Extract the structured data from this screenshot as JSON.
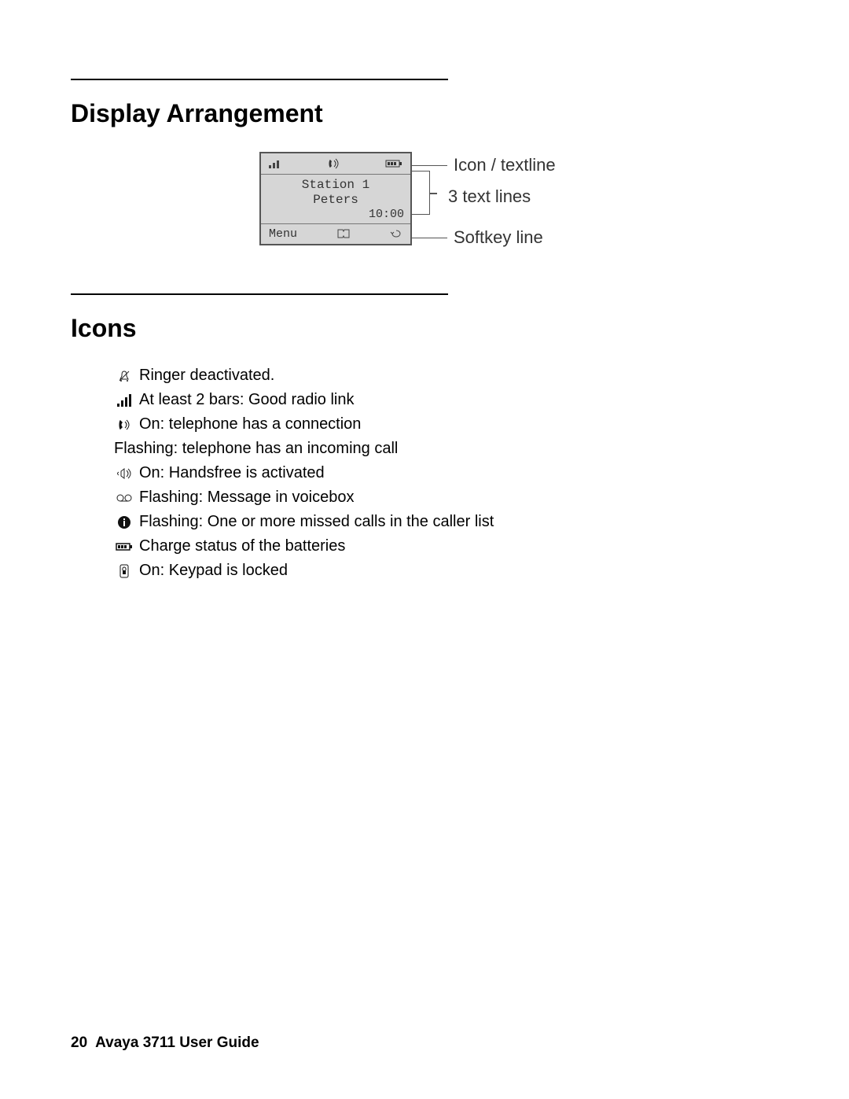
{
  "headings": {
    "display_arrangement": "Display Arrangement",
    "icons": "Icons"
  },
  "lcd": {
    "line1": "Station 1",
    "line2": "Peters",
    "time": "10:00",
    "menu": "Menu"
  },
  "callouts": {
    "top": "Icon / textline",
    "mid": "3 text lines",
    "bot": "Softkey line"
  },
  "icon_descriptions": {
    "ringer": "Ringer deactivated.",
    "signal": "At least 2 bars: Good radio link",
    "handset": "On: telephone has a connection",
    "flashing_call": "Flashing: telephone has an incoming call",
    "handsfree": "On: Handsfree is activated",
    "voicebox": "Flashing: Message in voicebox",
    "missed": "Flashing: One or more missed calls in the caller list",
    "battery": "Charge status of the batteries",
    "lock": "On: Keypad is locked"
  },
  "footer": {
    "page": "20",
    "title": "Avaya 3711 User Guide"
  }
}
